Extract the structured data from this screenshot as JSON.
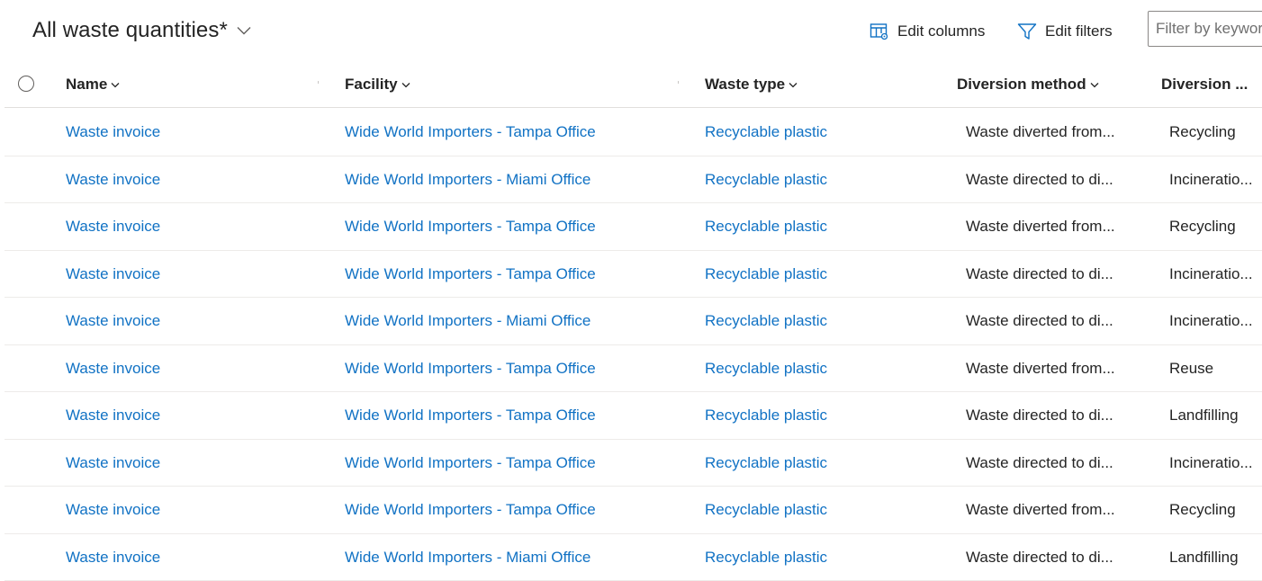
{
  "header": {
    "view_title": "All waste quantities*",
    "edit_columns": "Edit columns",
    "edit_filters": "Edit filters",
    "filter_placeholder": "Filter by keyword"
  },
  "columns": {
    "name": "Name",
    "facility": "Facility",
    "waste_type": "Waste type",
    "diversion_method": "Diversion method",
    "diversion_2": "Diversion ..."
  },
  "rows": [
    {
      "name": "Waste invoice",
      "facility": "Wide World Importers - Tampa Office",
      "waste_type": "Recyclable plastic",
      "diversion_method": "Waste diverted from...",
      "diversion_2": "Recycling"
    },
    {
      "name": "Waste invoice",
      "facility": "Wide World Importers - Miami Office",
      "waste_type": "Recyclable plastic",
      "diversion_method": "Waste directed to di...",
      "diversion_2": "Incineratio..."
    },
    {
      "name": "Waste invoice",
      "facility": "Wide World Importers - Tampa Office",
      "waste_type": "Recyclable plastic",
      "diversion_method": "Waste diverted from...",
      "diversion_2": "Recycling"
    },
    {
      "name": "Waste invoice",
      "facility": "Wide World Importers - Tampa Office",
      "waste_type": "Recyclable plastic",
      "diversion_method": "Waste directed to di...",
      "diversion_2": "Incineratio..."
    },
    {
      "name": "Waste invoice",
      "facility": "Wide World Importers - Miami Office",
      "waste_type": "Recyclable plastic",
      "diversion_method": "Waste directed to di...",
      "diversion_2": "Incineratio..."
    },
    {
      "name": "Waste invoice",
      "facility": "Wide World Importers - Tampa Office",
      "waste_type": "Recyclable plastic",
      "diversion_method": "Waste diverted from...",
      "diversion_2": "Reuse"
    },
    {
      "name": "Waste invoice",
      "facility": "Wide World Importers - Tampa Office",
      "waste_type": "Recyclable plastic",
      "diversion_method": "Waste directed to di...",
      "diversion_2": "Landfilling"
    },
    {
      "name": "Waste invoice",
      "facility": "Wide World Importers - Tampa Office",
      "waste_type": "Recyclable plastic",
      "diversion_method": "Waste directed to di...",
      "diversion_2": "Incineratio..."
    },
    {
      "name": "Waste invoice",
      "facility": "Wide World Importers - Tampa Office",
      "waste_type": "Recyclable plastic",
      "diversion_method": "Waste diverted from...",
      "diversion_2": "Recycling"
    },
    {
      "name": "Waste invoice",
      "facility": "Wide World Importers - Miami Office",
      "waste_type": "Recyclable plastic",
      "diversion_method": "Waste directed to di...",
      "diversion_2": "Landfilling"
    }
  ],
  "icons": {
    "view_selector": "chevron-down-icon",
    "edit_columns": "edit-columns-icon",
    "edit_filters": "filter-icon",
    "sort": "chevron-down-icon",
    "select_all": "circle-checkbox-icon"
  },
  "colors": {
    "link": "#1172c4",
    "text": "#242424",
    "border": "#e1dfdd"
  }
}
